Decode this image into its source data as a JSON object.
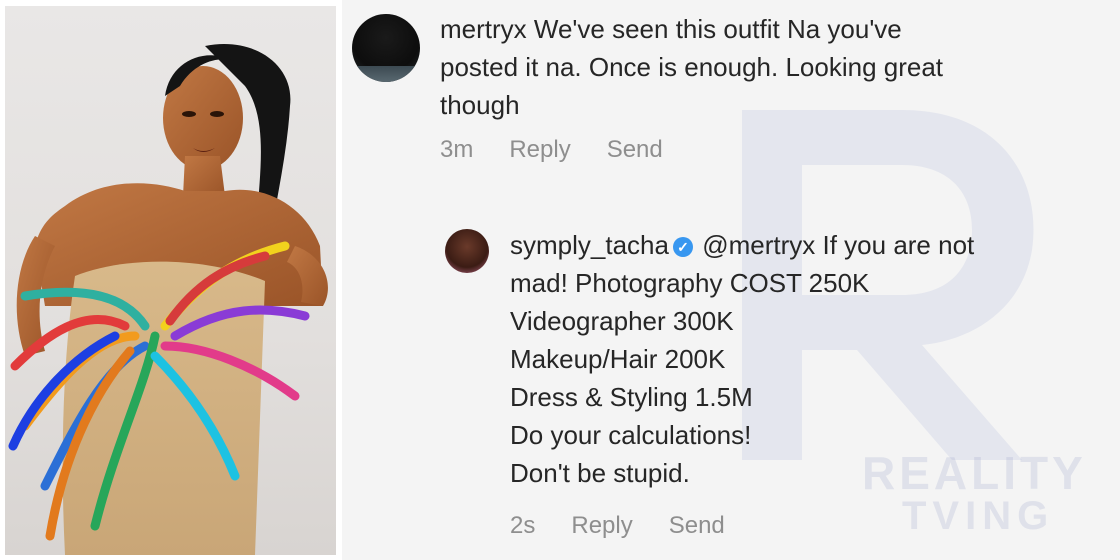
{
  "photo": {
    "alt_subject": "woman in colorful feathered dress",
    "icon": "photo-image"
  },
  "comments": [
    {
      "username": "mertryx",
      "lines": [
        "We've seen this outfit Na you've",
        "posted it na. Once is enough. Looking great",
        "though"
      ],
      "time": "3m",
      "reply_label": "Reply",
      "send_label": "Send"
    },
    {
      "username": "symply_tacha",
      "verified_icon": "verified-badge-icon",
      "mention": "@mertryx",
      "first_line_rest": "If you are not",
      "lines": [
        "mad! Photography COST 250K",
        "Videographer 300K",
        "Makeup/Hair 200K",
        "Dress & Styling 1.5M",
        "Do your calculations!",
        "Don't be stupid."
      ],
      "time": "2s",
      "reply_label": "Reply",
      "send_label": "Send"
    }
  ],
  "watermark": {
    "line1": "REALITY",
    "line2": "TVING",
    "letter": "R"
  },
  "colors": {
    "text": "#262626",
    "meta": "#8e8e8e",
    "verified": "#3897f0",
    "background": "#f4f4f4"
  }
}
